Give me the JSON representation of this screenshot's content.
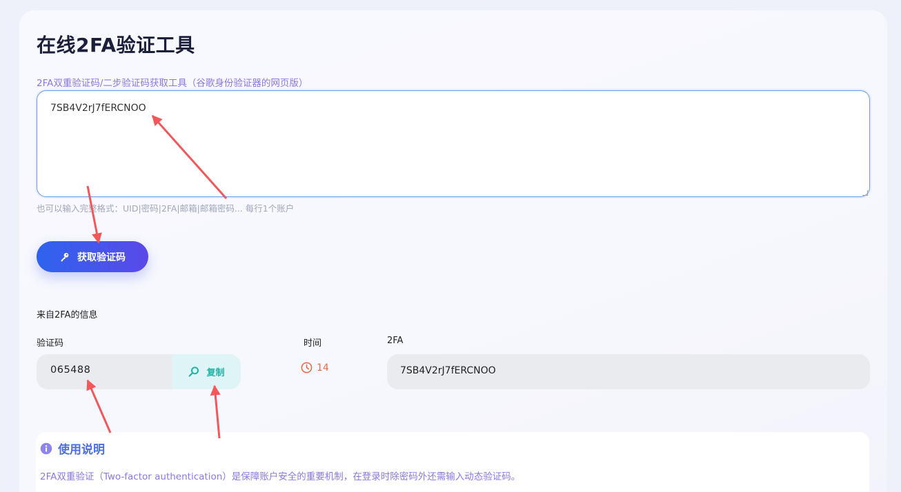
{
  "page": {
    "title": "在线2FA验证工具",
    "subtitle": "2FA双重验证码/二步验证码获取工具（谷歌身份验证器的网页版）",
    "hint": "也可以输入完整格式：UID|密码|2FA|邮箱|邮箱密码... 每行1个账户"
  },
  "secret_input": {
    "value": "7SB4V2rJ7fERCNOO"
  },
  "get_button": {
    "label": "获取验证码",
    "icon": "key-icon"
  },
  "result": {
    "heading": "来自2FA的信息",
    "code_label": "验证码",
    "code_value": "065488",
    "copy_label": "复制",
    "copy_icon": "search-icon",
    "time_label": "时间",
    "time_remaining": "14",
    "time_icon": "clock-icon",
    "twofa_label": "2FA",
    "twofa_value": "7SB4V2rJ7fERCNOO"
  },
  "usage": {
    "title": "使用说明",
    "icon": "info-icon",
    "description": "2FA双重验证（Two-factor authentication）是保障账户安全的重要机制，在登录时除密码外还需输入动态验证码。"
  },
  "colors": {
    "accent_blue": "#2f63ef",
    "accent_purple": "#5a49e8",
    "subtitle_purple": "#8b78e6",
    "copy_teal": "#22b3a6",
    "timer_orange": "#ef6a45",
    "annotation_red": "#f2575a"
  }
}
